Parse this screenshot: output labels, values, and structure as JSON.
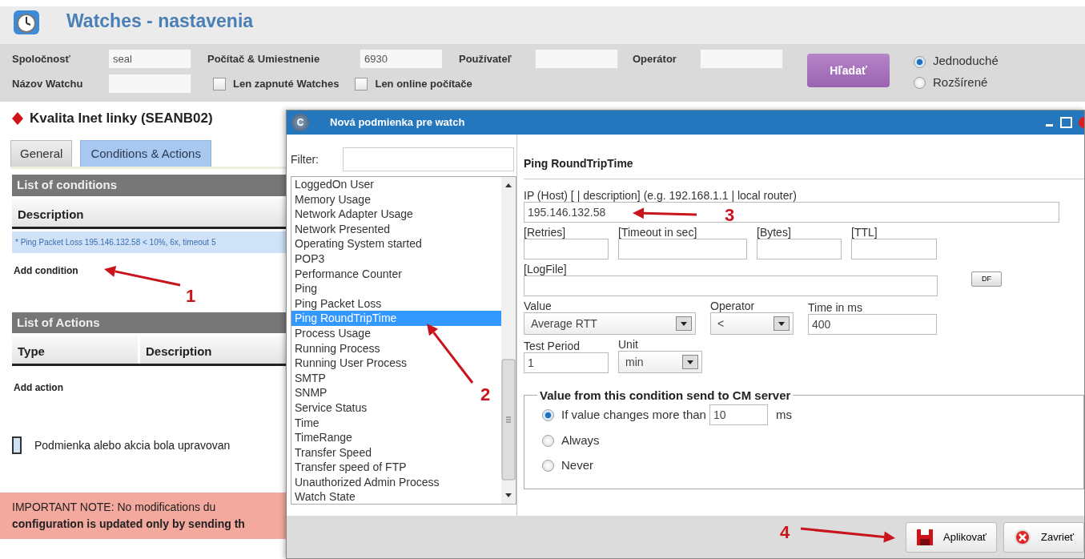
{
  "header": {
    "title": "Watches - nastavenia"
  },
  "filters": {
    "fields": [
      {
        "label": "Spoločnosť",
        "value": "seal"
      },
      {
        "label": "Počítač & Umiestnenie",
        "value": "6930"
      },
      {
        "label": "Používateľ"
      },
      {
        "label": "Operátor"
      },
      {
        "label": "Názov Watchu"
      }
    ],
    "checkboxes": [
      {
        "label": "Len zapnuté Watches",
        "checked": false
      },
      {
        "label": "Len online počítače",
        "checked": false
      }
    ],
    "search_button": "Hľadať",
    "modes": [
      {
        "label": "Jednoduché",
        "selected": true
      },
      {
        "label": "Rozšírené",
        "selected": false
      }
    ]
  },
  "watch": {
    "title": "Kvalita Inet linky (SEANB02)",
    "tabs": [
      {
        "label": "General",
        "selected": false
      },
      {
        "label": "Conditions & Actions",
        "selected": true
      }
    ],
    "conditions": {
      "heading": "List of conditions",
      "columns": [
        "Description"
      ],
      "rows": [
        "* Ping Packet Loss 195.146.132.58 < 10%, 6x, timeout 5"
      ],
      "add": "Add condition"
    },
    "actions": {
      "heading": "List of Actions",
      "columns": [
        "Type",
        "Description"
      ],
      "add": "Add action"
    },
    "legend": "Podmienka alebo akcia bola upravovan",
    "note": "IMPORTANT NOTE: No modifications du\n**configuration is updated only by sending th**"
  },
  "dialog": {
    "logo_letter": "C",
    "title": "Nová podmienka pre watch",
    "filter_label": "Filter:",
    "types": [
      {
        "label": "LoggedOn User",
        "selected": false
      },
      {
        "label": "Memory Usage",
        "selected": false
      },
      {
        "label": "Network Adapter Usage",
        "selected": false
      },
      {
        "label": "Network Presented",
        "selected": false
      },
      {
        "label": "Operating System started",
        "selected": false
      },
      {
        "label": "POP3",
        "selected": false
      },
      {
        "label": "Performance Counter",
        "selected": false
      },
      {
        "label": "Ping",
        "selected": false
      },
      {
        "label": "Ping Packet Loss",
        "selected": false
      },
      {
        "label": "Ping RoundTripTime",
        "selected": true
      },
      {
        "label": "Process Usage",
        "selected": false
      },
      {
        "label": "Running Process",
        "selected": false
      },
      {
        "label": "Running User Process",
        "selected": false
      },
      {
        "label": "SMTP",
        "selected": false
      },
      {
        "label": "SNMP",
        "selected": false
      },
      {
        "label": "Service Status",
        "selected": false
      },
      {
        "label": "Time",
        "selected": false
      },
      {
        "label": "TimeRange",
        "selected": false
      },
      {
        "label": "Transfer Speed",
        "selected": false
      },
      {
        "label": "Transfer speed of FTP",
        "selected": false
      },
      {
        "label": "Unauthorized Admin Process",
        "selected": false
      },
      {
        "label": "Watch State",
        "selected": false
      }
    ],
    "form": {
      "heading": "Ping RoundTripTime",
      "host": {
        "label": "IP (Host) [ | description] (e.g. 192.168.1.1 | local router)",
        "value": "195.146.132.58"
      },
      "options": [
        {
          "label": "[Retries]"
        },
        {
          "label": "[Timeout in sec]"
        },
        {
          "label": "[Bytes]"
        },
        {
          "label": "[TTL]"
        }
      ],
      "logfile": {
        "label": "[LogFile]"
      },
      "df_button": "DF",
      "value": {
        "label": "Value",
        "selected": "Average RTT"
      },
      "operator": {
        "label": "Operator",
        "selected": "<"
      },
      "time": {
        "label": "Time in ms",
        "value": "400"
      },
      "test_period": {
        "label": "Test Period",
        "value": "1"
      },
      "unit": {
        "label": "Unit",
        "selected": "min"
      },
      "send": {
        "legend": "Value from this condition send to CM server",
        "options": [
          {
            "kind": "threshold",
            "label": "If value changes more than",
            "value": "10",
            "suffix": "ms",
            "selected": true
          },
          {
            "kind": "plain",
            "label": "Always",
            "selected": false
          },
          {
            "kind": "plain",
            "label": "Never",
            "selected": false
          }
        ]
      }
    },
    "buttons": [
      {
        "kind": "save",
        "label": "Aplikovať"
      },
      {
        "kind": "close",
        "label": "Zavrieť"
      }
    ]
  },
  "annotations": [
    "1",
    "2",
    "3",
    "4"
  ]
}
